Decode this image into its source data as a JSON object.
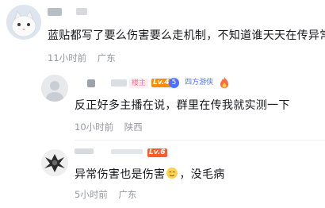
{
  "comments": [
    {
      "text": "蓝贴都写了要么伤害要么走机制，不知道谁天天在传异常",
      "time": "11小时前",
      "location": "广东"
    },
    {
      "text": "反正好多主播在说，群里在传我就实测一下",
      "time": "10小时前",
      "location": "陕西",
      "badges": {
        "owner": "楼主",
        "level": "Lv.4",
        "fan_level": "5",
        "fan_name": "四方游侠"
      }
    },
    {
      "text_before": "异常伤害也是伤害",
      "text_after": "，没毛病",
      "time": "5小时前",
      "location": "广东",
      "level": "Lv.6"
    }
  ],
  "colors": {
    "owner_badge": "#fb7299",
    "level_orange": "#ff8c00",
    "fan_badge_blue": "#4f6fff"
  }
}
